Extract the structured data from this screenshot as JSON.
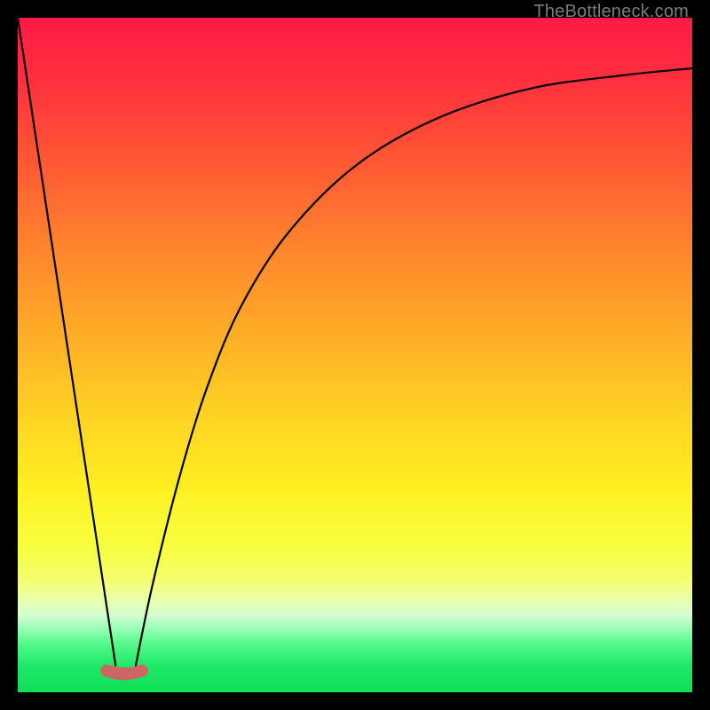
{
  "watermark": "TheBottleneck.com",
  "chart_data": {
    "type": "line",
    "title": "",
    "xlabel": "",
    "ylabel": "",
    "xlim": [
      0,
      100
    ],
    "ylim": [
      0,
      100
    ],
    "series": [
      {
        "name": "left-segment",
        "x": [
          0,
          14.5
        ],
        "values": [
          100,
          4
        ]
      },
      {
        "name": "right-segment",
        "x": [
          17.5,
          20,
          24,
          28,
          33,
          40,
          50,
          62,
          76,
          90,
          100
        ],
        "values": [
          4,
          16,
          32,
          45,
          57,
          68,
          78,
          85,
          89.5,
          91.5,
          92.5
        ]
      }
    ],
    "valley_marker": {
      "x_start": 13.2,
      "x_end": 18.4,
      "y": 3.2
    },
    "gradient_stops": [
      {
        "pos": 0,
        "color": "#ff1a45"
      },
      {
        "pos": 9,
        "color": "#ff2f3e"
      },
      {
        "pos": 22,
        "color": "#ff5a34"
      },
      {
        "pos": 34,
        "color": "#ff842d"
      },
      {
        "pos": 46,
        "color": "#ffaa28"
      },
      {
        "pos": 58,
        "color": "#ffd024"
      },
      {
        "pos": 70,
        "color": "#fff022"
      },
      {
        "pos": 78.5,
        "color": "#f7ff40"
      },
      {
        "pos": 81,
        "color": "#f5ff55"
      },
      {
        "pos": 83.5,
        "color": "#f4ff74"
      },
      {
        "pos": 86,
        "color": "#ecffa8"
      },
      {
        "pos": 88.5,
        "color": "#d5ffd0"
      },
      {
        "pos": 90.5,
        "color": "#9bffb8"
      },
      {
        "pos": 93,
        "color": "#52f889"
      },
      {
        "pos": 96,
        "color": "#1fe968"
      },
      {
        "pos": 100,
        "color": "#0fde57"
      }
    ]
  }
}
